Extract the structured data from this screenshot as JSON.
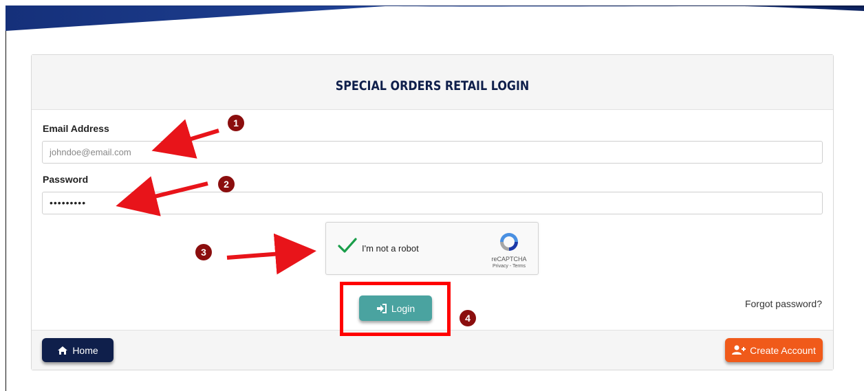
{
  "form": {
    "title": "SPECIAL ORDERS RETAIL LOGIN",
    "email_label": "Email Address",
    "email_value": "johndoe@email.com",
    "password_label": "Password",
    "password_value": "•••••••••",
    "forgot_label": "Forgot password?",
    "login_label": "Login"
  },
  "captcha": {
    "label": "I'm not a robot",
    "brand": "reCAPTCHA",
    "terms": "Privacy - Terms",
    "checked": true
  },
  "footer": {
    "home_label": "Home",
    "create_label": "Create Account"
  },
  "annotations": {
    "steps": [
      "1",
      "2",
      "3",
      "4"
    ]
  },
  "colors": {
    "navy": "#0f1f4b",
    "teal": "#4aa3a0",
    "orange": "#f05a1a",
    "arrow": "#e8141a",
    "badge": "#8b0e0e"
  }
}
